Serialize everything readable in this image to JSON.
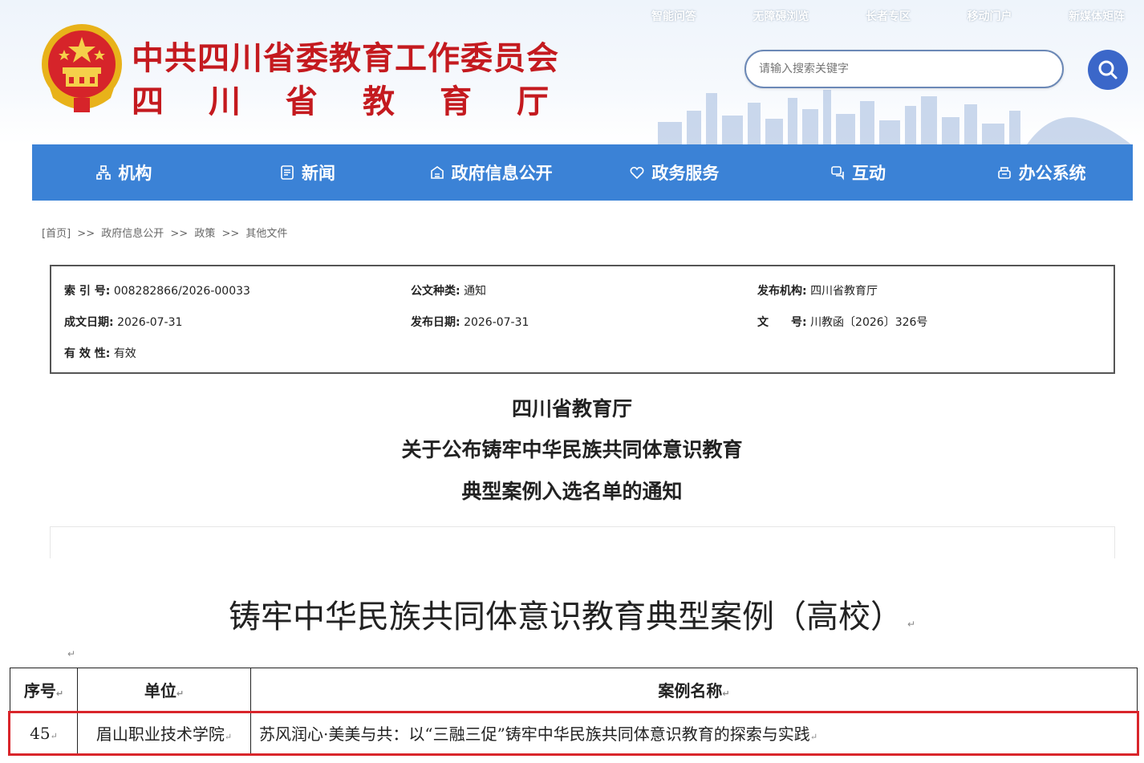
{
  "header": {
    "title_line1": "中共四川省委教育工作委员会",
    "title_line2": [
      "四",
      "川",
      "省",
      "教",
      "育",
      "厅"
    ],
    "top_links": [
      "智能问答",
      "无障碍浏览",
      "长者专区",
      "移动门户",
      "新媒体矩阵"
    ],
    "search": {
      "placeholder": "请输入搜索关键字"
    }
  },
  "nav": {
    "items": [
      {
        "label": "机构",
        "icon": "org-icon"
      },
      {
        "label": "新闻",
        "icon": "news-icon"
      },
      {
        "label": "政府信息公开",
        "icon": "info-icon"
      },
      {
        "label": "政务服务",
        "icon": "heart-icon"
      },
      {
        "label": "互动",
        "icon": "chat-icon"
      },
      {
        "label": "办公系统",
        "icon": "office-icon"
      }
    ],
    "color": "#3b82d6"
  },
  "breadcrumb": [
    "[首页]",
    ">>",
    "政府信息公开",
    ">>",
    "政策",
    ">>",
    "其他文件"
  ],
  "info": {
    "index_label": "索 引 号:",
    "index_value": "008282866/2026-00033",
    "type_label": "公文种类:",
    "type_value": "通知",
    "publisher_label": "发布机构:",
    "publisher_value": "四川省教育厅",
    "written_label": "成文日期:",
    "written_value": "2026-07-31",
    "published_label": "发布日期:",
    "published_value": "2026-07-31",
    "docno_label": "文　　号:",
    "docno_value": "川教函〔2026〕326号",
    "valid_label": "有 效 性:",
    "valid_value": "有效"
  },
  "doc": {
    "title_line1": "四川省教育厅",
    "title_line2": "关于公布铸牢中华民族共同体意识教育",
    "title_line3": "典型案例入选名单的通知"
  },
  "case_section": {
    "title": "铸牢中华民族共同体意识教育典型案例（高校）",
    "paragraph_mark": "↵",
    "headers": [
      "序号",
      "单位",
      "案例名称"
    ],
    "rows": [
      {
        "no": "45",
        "unit": "眉山职业技术学院",
        "case": "苏风润心·美美与共：以“三融三促”铸牢中华民族共同体意识教育的探索与实践"
      }
    ],
    "highlight_color": "#d9252b"
  }
}
